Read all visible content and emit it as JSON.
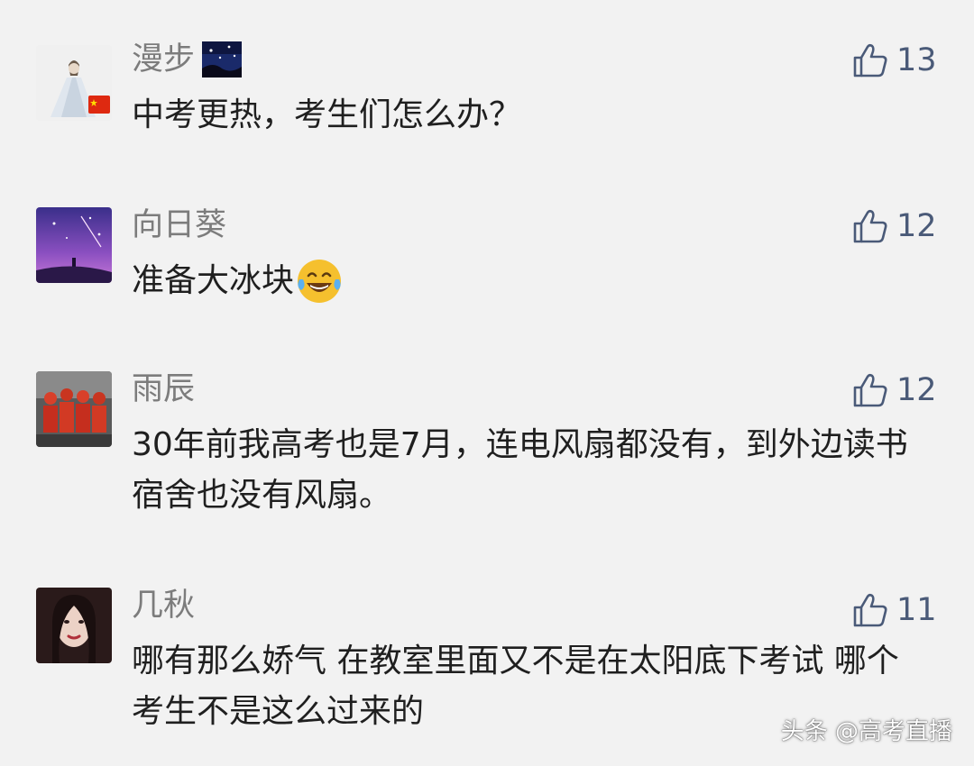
{
  "comments": [
    {
      "username": "漫步",
      "text": "中考更热，考生们怎么办？",
      "likes": "13",
      "avatar_icon": "avatar-woman-white-dress-icon",
      "has_flag": true,
      "name_badge_icon": "starry-night-badge-icon"
    },
    {
      "username": "向日葵",
      "text": "准备大冰块",
      "emoji": "laughing-tears-emoji-icon",
      "likes": "12",
      "avatar_icon": "avatar-purple-night-sky-icon"
    },
    {
      "username": "雨辰",
      "text": "30年前我高考也是7月，连电风扇都没有，到外边读书宿舍也没有风扇。",
      "likes": "12",
      "avatar_icon": "avatar-red-group-icon"
    },
    {
      "username": "几秋",
      "text": "哪有那么娇气 在教室里面又不是在太阳底下考试 哪个考生不是这么过来的",
      "likes": "11",
      "avatar_icon": "avatar-woman-portrait-icon"
    }
  ],
  "watermark": "头条 @高考直播",
  "colors": {
    "background": "#f2f2f2",
    "username": "#7c7c7c",
    "comment_text": "#1f1f1f",
    "like_icon": "#4a5a78"
  }
}
